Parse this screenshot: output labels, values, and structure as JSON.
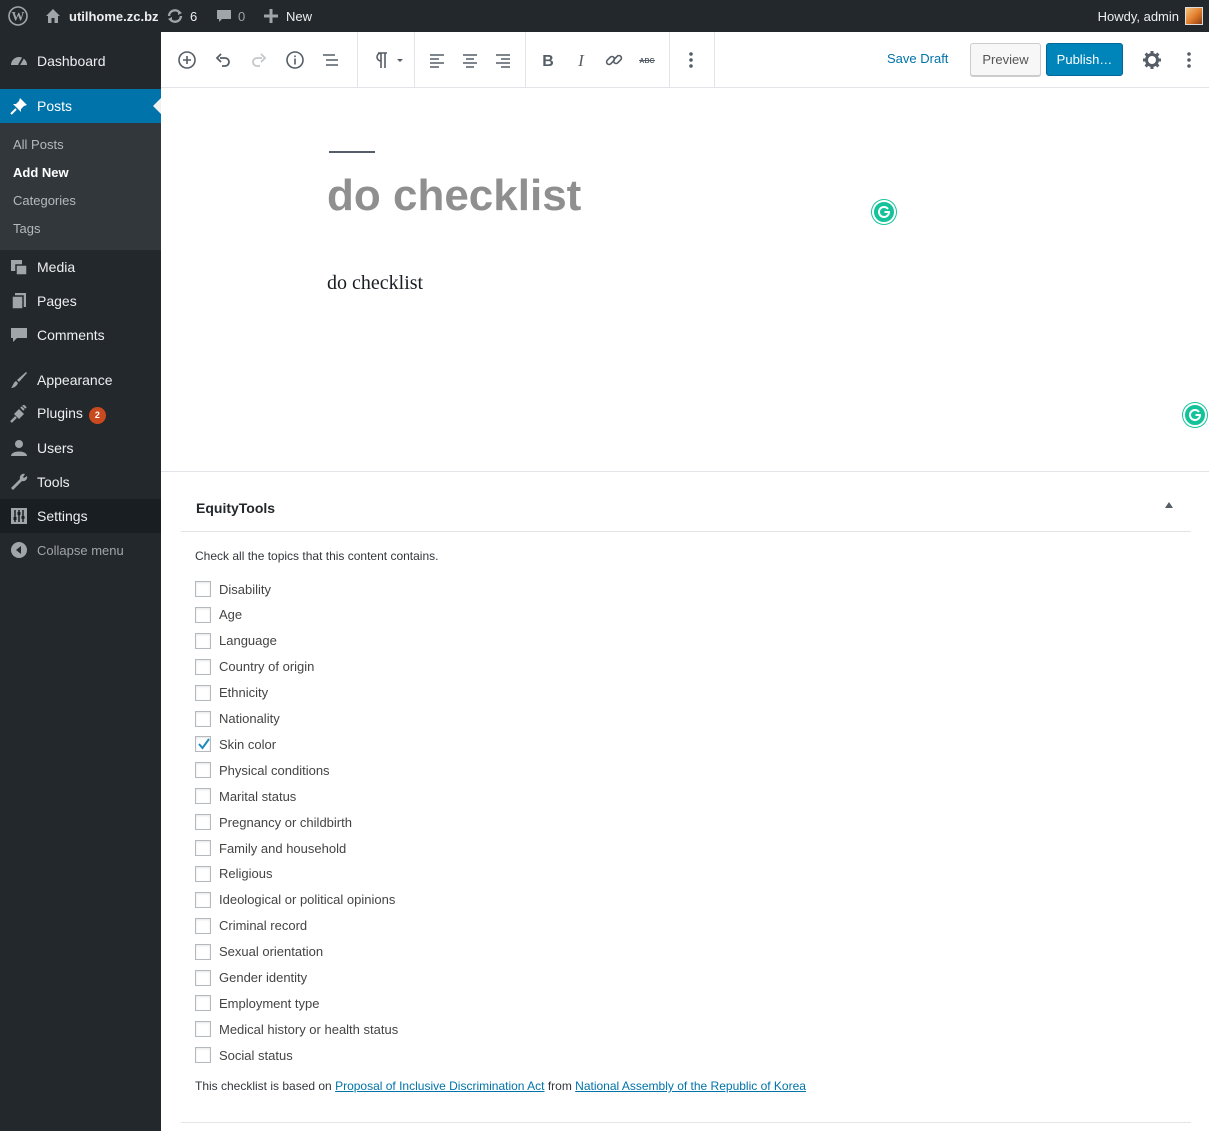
{
  "adminbar": {
    "site_name": "utilhome.zc.bz",
    "updates_count": "6",
    "comments_count": "0",
    "new_label": "New",
    "howdy": "Howdy, admin"
  },
  "sidebar": {
    "dashboard": "Dashboard",
    "posts": "Posts",
    "submenu": [
      "All Posts",
      "Add New",
      "Categories",
      "Tags"
    ],
    "media": "Media",
    "pages": "Pages",
    "comments": "Comments",
    "appearance": "Appearance",
    "plugins": "Plugins",
    "plugins_badge": "2",
    "users": "Users",
    "tools": "Tools",
    "settings": "Settings",
    "collapse": "Collapse menu"
  },
  "toolbar": {
    "save_draft": "Save Draft",
    "preview": "Preview",
    "publish": "Publish…"
  },
  "editor": {
    "title": "do checklist",
    "body": "do checklist"
  },
  "metabox": {
    "title": "EquityTools",
    "description": "Check all the topics that this content contains.",
    "items": [
      {
        "label": "Disability",
        "checked": false
      },
      {
        "label": "Age",
        "checked": false
      },
      {
        "label": "Language",
        "checked": false
      },
      {
        "label": "Country of origin",
        "checked": false
      },
      {
        "label": "Ethnicity",
        "checked": false
      },
      {
        "label": "Nationality",
        "checked": false
      },
      {
        "label": "Skin color",
        "checked": true
      },
      {
        "label": "Physical conditions",
        "checked": false
      },
      {
        "label": "Marital status",
        "checked": false
      },
      {
        "label": "Pregnancy or childbirth",
        "checked": false
      },
      {
        "label": "Family and household",
        "checked": false
      },
      {
        "label": "Religious",
        "checked": false
      },
      {
        "label": "Ideological or political opinions",
        "checked": false
      },
      {
        "label": "Criminal record",
        "checked": false
      },
      {
        "label": "Sexual orientation",
        "checked": false
      },
      {
        "label": "Gender identity",
        "checked": false
      },
      {
        "label": "Employment type",
        "checked": false
      },
      {
        "label": "Medical history or health status",
        "checked": false
      },
      {
        "label": "Social status",
        "checked": false
      }
    ],
    "footer": {
      "prefix": "This checklist is based on ",
      "link1": "Proposal of Inclusive Discrimination Act",
      "middle": " from ",
      "link2": "National Assembly of the Republic of Korea"
    }
  },
  "colors": {
    "admin_dark": "#23282d",
    "accent": "#0073aa",
    "publish": "#0085ba",
    "grammarly": "#15c39a"
  }
}
